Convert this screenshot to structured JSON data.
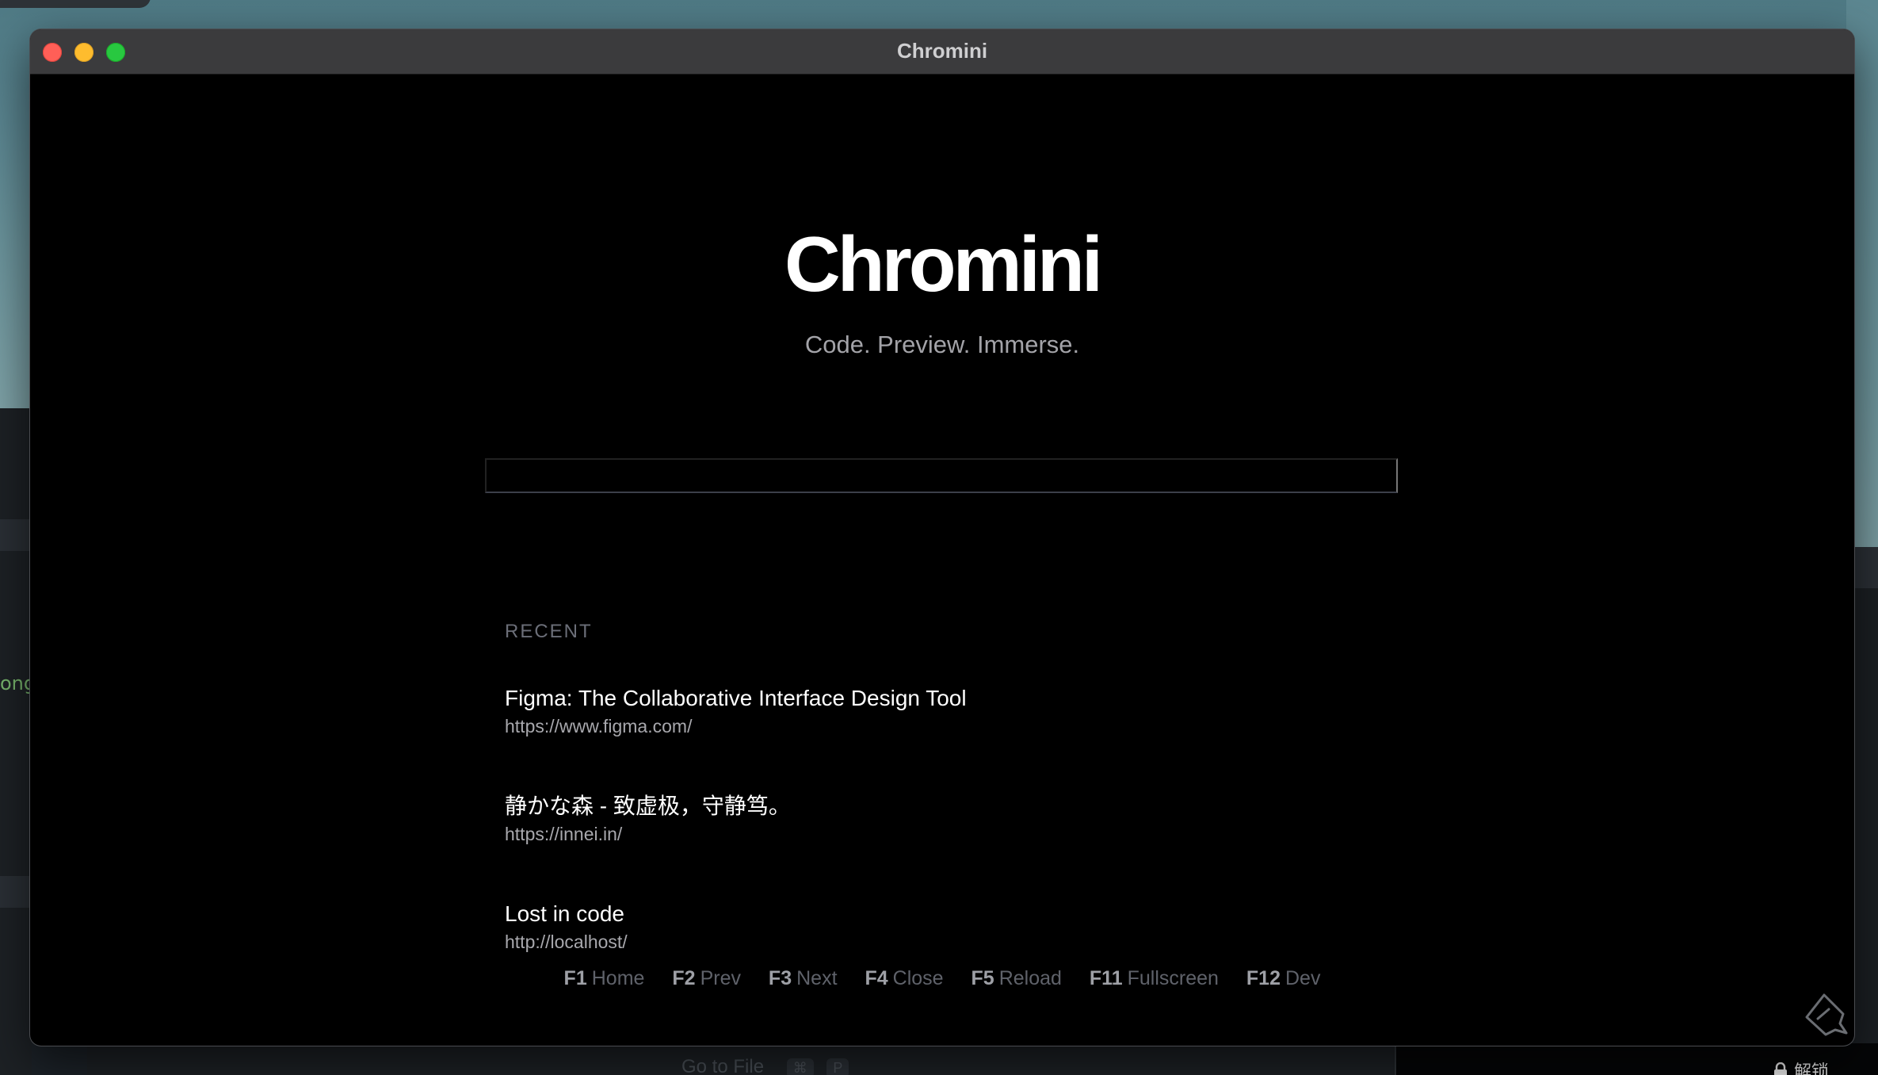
{
  "window": {
    "title": "Chromini"
  },
  "page": {
    "brand": "Chromini",
    "tagline": "Code. Preview. Immerse.",
    "address_value": "",
    "recent_label": "RECENT",
    "recent": [
      {
        "title": "Figma: The Collaborative Interface Design Tool",
        "url": "https://www.figma.com/"
      },
      {
        "title": "静かな森 - 致虚极，守静笃。",
        "url": "https://innei.in/"
      },
      {
        "title": "Lost in code",
        "url": "http://localhost/"
      }
    ],
    "shortcuts": [
      {
        "key": "F1",
        "label": "Home"
      },
      {
        "key": "F2",
        "label": "Prev"
      },
      {
        "key": "F3",
        "label": "Next"
      },
      {
        "key": "F4",
        "label": "Close"
      },
      {
        "key": "F5",
        "label": "Reload"
      },
      {
        "key": "F11",
        "label": "Fullscreen"
      },
      {
        "key": "F12",
        "label": "Dev"
      }
    ]
  },
  "background": {
    "left_partial_text": "ong",
    "goto_file_label": "Go to File",
    "goto_file_keys": [
      "⌘",
      "P"
    ],
    "unlock_label": "解锁"
  },
  "colors": {
    "window_bg": "#000000",
    "titlebar_bg": "#3b3b3d",
    "close": "#ff5f57",
    "minimize": "#febc2e",
    "zoom": "#28c840",
    "muted_text": "#a3a3a8",
    "divider": "#3c3f4a"
  },
  "icons": [
    "close-icon",
    "minimize-icon",
    "zoom-icon",
    "lock-icon",
    "ai-assistant-icon"
  ]
}
